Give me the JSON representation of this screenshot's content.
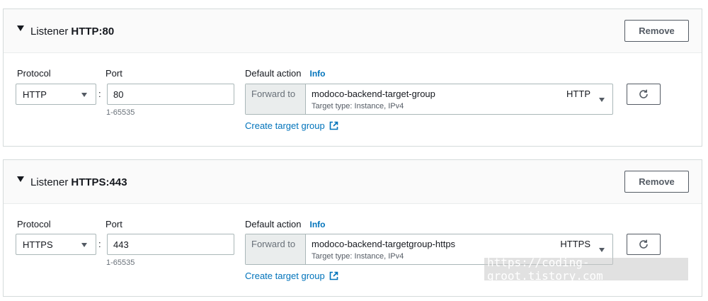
{
  "listeners": [
    {
      "title_prefix": "Listener",
      "title_name": "HTTP:80",
      "remove_label": "Remove",
      "protocol_label": "Protocol",
      "protocol_value": "HTTP",
      "port_label": "Port",
      "port_value": "80",
      "port_hint": "1-65535",
      "default_action_label": "Default action",
      "info_label": "Info",
      "forward_to_label": "Forward to",
      "target_group_name": "modoco-backend-target-group",
      "target_type": "Target type: Instance, IPv4",
      "target_group_protocol": "HTTP",
      "create_target_group_label": "Create target group"
    },
    {
      "title_prefix": "Listener",
      "title_name": "HTTPS:443",
      "remove_label": "Remove",
      "protocol_label": "Protocol",
      "protocol_value": "HTTPS",
      "port_label": "Port",
      "port_value": "443",
      "port_hint": "1-65535",
      "default_action_label": "Default action",
      "info_label": "Info",
      "forward_to_label": "Forward to",
      "target_group_name": "modoco-backend-targetgroup-https",
      "target_type": "Target type: Instance, IPv4",
      "target_group_protocol": "HTTPS",
      "create_target_group_label": "Create target group"
    }
  ],
  "colon": ":",
  "watermark": "https://coding-groot.tistory.com",
  "icons": {
    "expand": "caret-down-icon",
    "select": "chevron-down-icon",
    "refresh": "refresh-icon",
    "external": "external-link-icon"
  },
  "colors": {
    "link": "#0073bb",
    "border": "#aab7b8",
    "button_border": "#545b64"
  }
}
